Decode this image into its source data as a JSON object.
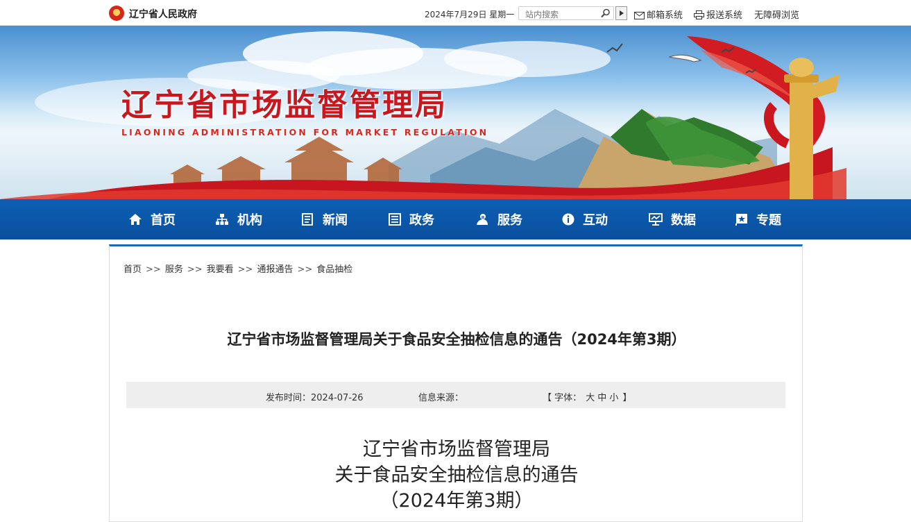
{
  "topbar": {
    "gov_name": "辽宁省人民政府",
    "date": "2024年7月29日 星期一",
    "search_placeholder": "站内搜索",
    "mail": "邮箱系统",
    "report": "报送系统",
    "accessible": "无障碍浏览"
  },
  "banner": {
    "title": "辽宁省市场监督管理局",
    "subtitle": "LIAONING ADMINISTRATION FOR MARKET REGULATION"
  },
  "nav": [
    {
      "label": "首页",
      "icon": "home-icon"
    },
    {
      "label": "机构",
      "icon": "org-chart-icon"
    },
    {
      "label": "新闻",
      "icon": "news-icon"
    },
    {
      "label": "政务",
      "icon": "list-icon"
    },
    {
      "label": "服务",
      "icon": "service-icon"
    },
    {
      "label": "互动",
      "icon": "info-icon"
    },
    {
      "label": "数据",
      "icon": "data-icon"
    },
    {
      "label": "专题",
      "icon": "topic-flag-icon"
    }
  ],
  "breadcrumb": [
    "首页",
    "服务",
    "我要看",
    "通报通告",
    "食品抽检"
  ],
  "breadcrumb_sep": ">>",
  "article": {
    "title": "辽宁省市场监督管理局关于食品安全抽检信息的通告（2024年第3期）",
    "publish_label": "发布时间：2024-07-26",
    "source_label": "信息来源：",
    "font_open": "【 字体：",
    "font_large": "大",
    "font_medium": "中",
    "font_small": "小",
    "font_close": "】",
    "body_heading": [
      "辽宁省市场监督管理局",
      "关于食品安全抽检信息的通告",
      "（2024年第3期）"
    ]
  },
  "colors": {
    "nav_blue": "#0a4f9e",
    "brand_red": "#c8171e",
    "accent_border": "#1b67b8"
  }
}
